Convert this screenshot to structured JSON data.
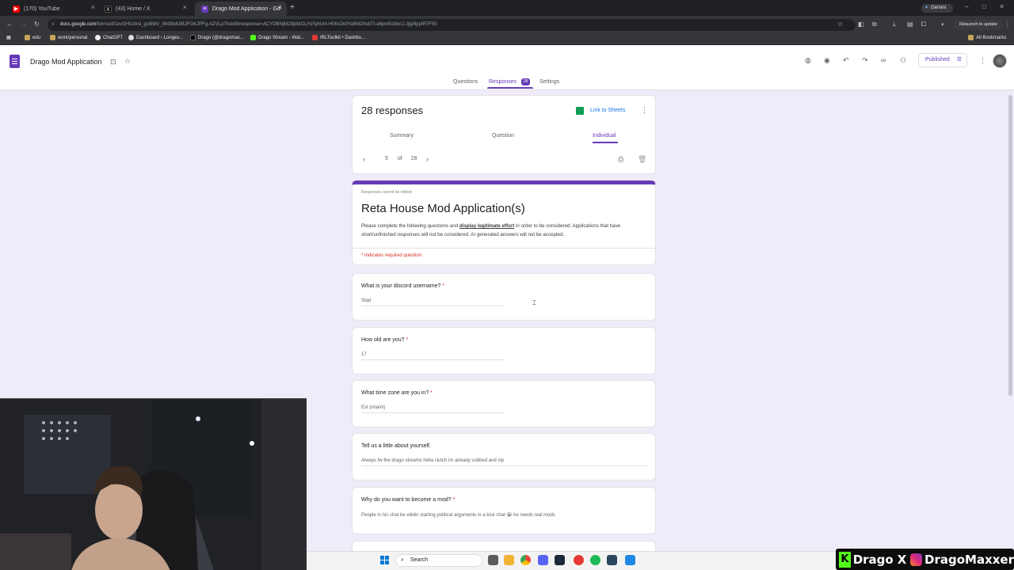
{
  "browser": {
    "tabs": [
      {
        "label": "(170) YouTube",
        "active": false
      },
      {
        "label": "(43) Home / X",
        "active": false
      },
      {
        "label": "Drago Mod Application - Goo",
        "active": true
      }
    ],
    "new_tab": "+",
    "gemini_label": "Gemini",
    "url_domain": "docs.google.com",
    "url_path": "/forms/d/1ovGHUzksl_gc8iMV_8M3bdUlBJFGKJPFg-AZVLpTk/edit#response=ACYDBNjM29jdbrDLHzSj4Um-H0hx2k0Ya6Nt2hsbTI-a6pmEd3oc1-3jg/ltppIR7F50",
    "relaunch_label": "Relaunch to update",
    "bookmarks": [
      "edu",
      "work/personal",
      "ChatGPT",
      "Dashboard ‹ Longev...",
      "Drago (@dragomax...",
      "Drago Stream - Wat...",
      "IRLToolkit • Dashbo..."
    ],
    "all_bookmarks": "All Bookmarks"
  },
  "form_header": {
    "title": "Drago Mod Application",
    "published_label": "Published",
    "tabs": [
      "Questions",
      "Responses",
      "Settings"
    ],
    "responses_badge": "28"
  },
  "summary": {
    "count_text": "28 responses",
    "link_sheets": "Link to Sheets",
    "subtabs": [
      "Summary",
      "Question",
      "Individual"
    ],
    "current": "5",
    "of_label": "of",
    "total": "28"
  },
  "form": {
    "cannot_edit": "Responses cannot be edited",
    "title": "Reta House Mod Application(s)",
    "desc_before": "Please complete the following questions and ",
    "desc_link": "display legitimate effort",
    "desc_after": " in order to be considered. Applications that have short/unfinished responses will not be considered. AI generated answers will not be accepted.",
    "required_note": "* Indicates required question"
  },
  "questions": [
    {
      "q": "What is your discord username?",
      "a": "Siqd",
      "required": "*"
    },
    {
      "q": "How old are you?",
      "a": "17",
      "required": "*"
    },
    {
      "q": "What time zone are you in?",
      "a": "Est (miami)",
      "required": "*"
    },
    {
      "q": "Tell us a little about yourself.",
      "a": "Always fw the drago streams hella clutch im already subbed and vip",
      "required": ""
    },
    {
      "q": "Why do you want to become a mod?",
      "a": "People in his chat be wildin starting political arguments in a kick chat 😭 he needs real mods",
      "required": "*"
    }
  ],
  "taskbar": {
    "search_label": "Search"
  },
  "watermark": {
    "name1": "Drago",
    "x": "X",
    "name2": "DragoMaxxer"
  },
  "colors": {
    "accent": "#673ab7",
    "background": "#f0ebf8",
    "required": "#d93025",
    "link": "#1a73e8"
  }
}
